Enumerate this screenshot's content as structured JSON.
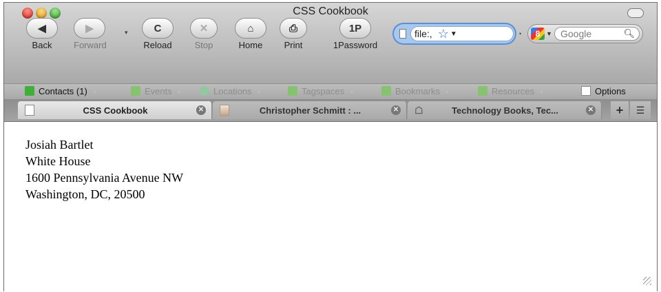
{
  "window": {
    "title": "CSS Cookbook"
  },
  "toolbar": {
    "buttons": [
      {
        "id": "back",
        "icon": "◀",
        "label": "Back"
      },
      {
        "id": "forward",
        "icon": "▶",
        "label": "Forward"
      },
      {
        "id": "reload",
        "icon": "C",
        "label": "Reload"
      },
      {
        "id": "stop",
        "icon": "✕",
        "label": "Stop"
      },
      {
        "id": "home",
        "icon": "⌂",
        "label": "Home"
      },
      {
        "id": "print",
        "icon": "⎙",
        "label": "Print"
      },
      {
        "id": "onepassword",
        "icon": "1P",
        "label": "1Password"
      }
    ],
    "url": "file:,",
    "search_placeholder": "Google",
    "search_logo": "8"
  },
  "bookmarks": [
    {
      "label": "Contacts (1)",
      "active": true
    },
    {
      "label": "Events",
      "active": false
    },
    {
      "label": "Locations",
      "active": false
    },
    {
      "label": "Tagspaces",
      "active": false
    },
    {
      "label": "Bookmarks",
      "active": false
    },
    {
      "label": "Resources",
      "active": false
    },
    {
      "label": "Options",
      "active": true
    }
  ],
  "tabs": [
    {
      "label": "CSS Cookbook",
      "selected": true
    },
    {
      "label": "Christopher Schmitt : ...",
      "selected": false
    },
    {
      "label": "Technology Books, Tec...",
      "selected": false
    }
  ],
  "tab_new_label": "+",
  "address": {
    "name": "Josiah Bartlet",
    "org": "White House",
    "street": "1600 Pennsylvania Avenue NW",
    "city": "Washington, DC, 20500"
  },
  "colors": {
    "accent": "#5a8fd6",
    "contacts_icon": "#3fae3a"
  }
}
